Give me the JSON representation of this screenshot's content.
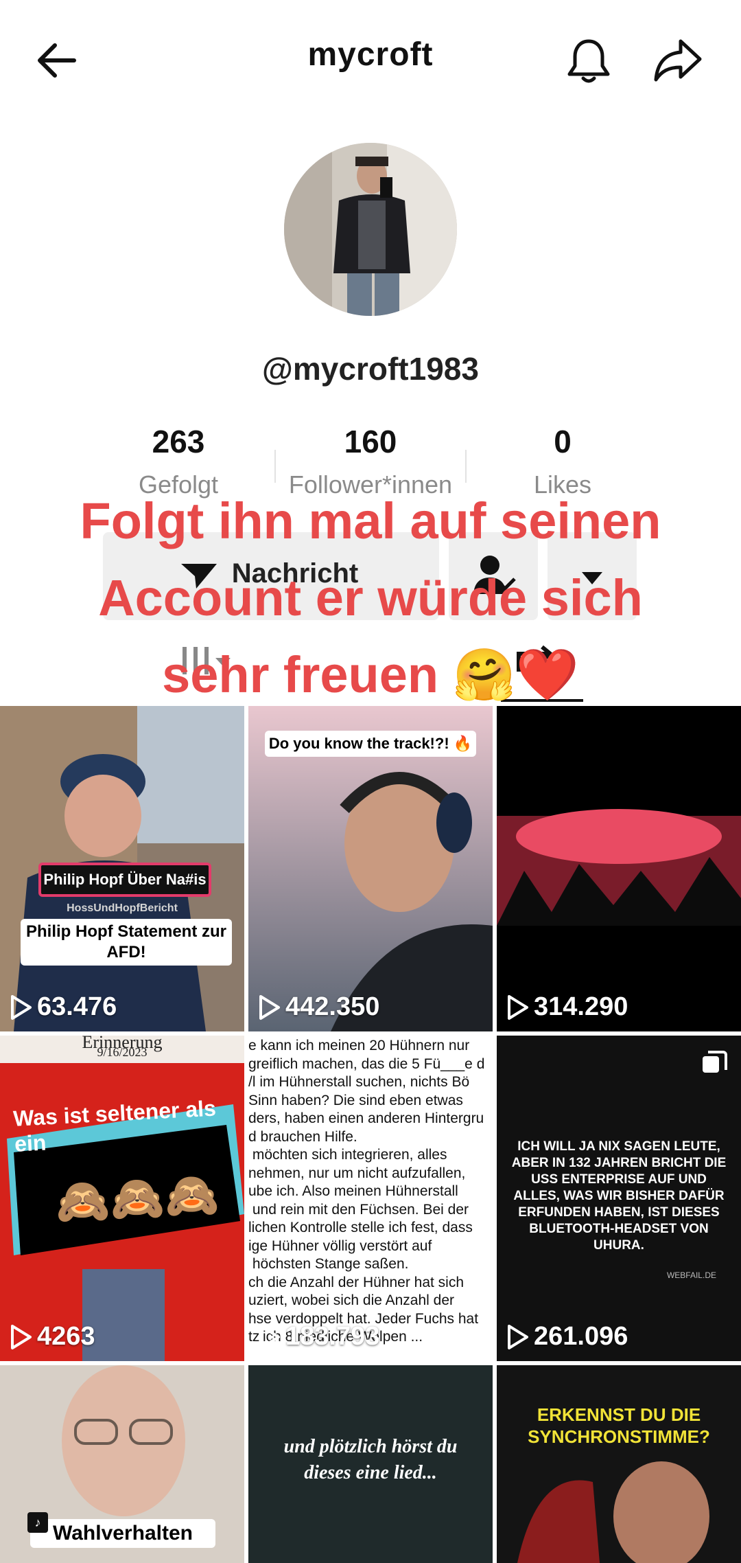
{
  "header": {
    "title": "mycroft",
    "back_icon": "arrow-left-icon",
    "bell_icon": "bell-icon",
    "share_icon": "share-arrow-icon"
  },
  "profile": {
    "username": "@mycroft1983",
    "stats": [
      {
        "value": "263",
        "label": "Gefolgt"
      },
      {
        "value": "160",
        "label": "Follower*innen"
      },
      {
        "value": "0",
        "label": "Likes"
      }
    ],
    "buttons": {
      "message_label": "Nachricht"
    }
  },
  "overlay_text": {
    "line1": "Folgt ihn mal auf seinen",
    "line2": "Account er würde sich",
    "line3": "sehr freuen",
    "emoji": "🤗❤️"
  },
  "videos": [
    {
      "views": "63.476",
      "caption_top": "Philip Hopf Über Na#is",
      "caption_tag": "HossUndHopfBericht",
      "caption_main": "Philip Hopf Statement zur AFD!"
    },
    {
      "views": "442.350",
      "caption_top": "Do you know the track!?! 🔥"
    },
    {
      "views": "314.290"
    },
    {
      "views": "4263",
      "header_text": "Erinnerung",
      "date": "9/16/2023",
      "caption_main": "Was ist seltener als ein",
      "emoji": "🙈🙈🙈"
    },
    {
      "views": "183.793",
      "lines": [
        "e kann ich meinen 20 Hühnern nur",
        "greiflich machen, das die 5 Fü___e d",
        "/l im Hühnerstall suchen, nichts Bö",
        "Sinn haben? Die sind eben etwas",
        "ders, haben einen anderen Hintergru",
        "d brauchen Hilfe.",
        " möchten sich integrieren, alles",
        "nehmen, nur um nicht aufzufallen,",
        "ube ich. Also meinen Hühnerstall",
        " und rein mit den Füchsen. Bei der",
        "lichen Kontrolle stelle ich fest, dass",
        "ige Hühner völlig verstört auf",
        " höchsten Stange saßen.",
        "ch die Anzahl der Hühner hat sich",
        "uziert, wobei sich die Anzahl der",
        "hse verdoppelt hat. Jeder Fuchs hat",
        "tzlich 8 niedliche Welpen ..."
      ]
    },
    {
      "views": "261.096",
      "caption_main": "ICH WILL JA NIX SAGEN LEUTE, ABER IN 132 JAHREN BRICHT DIE USS ENTERPRISE AUF UND ALLES, WAS WIR BISHER DAFÜR ERFUNDEN HABEN, IST DIESES BLUETOOTH-HEADSET VON UHURA.",
      "source": "WEBFAIL.DE"
    },
    {
      "views": "",
      "caption_main": "Wahlverhalten"
    },
    {
      "views": "",
      "caption_main": "und plötzlich hörst du dieses eine lied..."
    },
    {
      "views": "",
      "caption_main": "ERKENNST DU DIE SYNCHRONSTIMME?"
    }
  ],
  "colors": {
    "overlay": "#e74a4a",
    "button_bg": "#efefef",
    "muted_label": "#8a8a8a"
  }
}
